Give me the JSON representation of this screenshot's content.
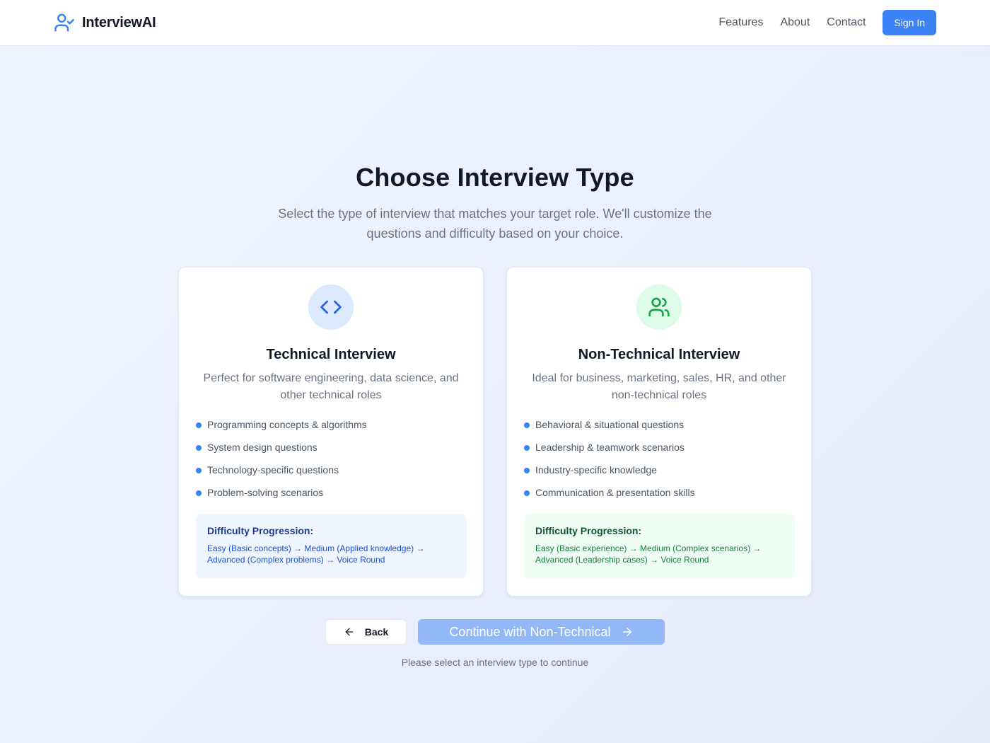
{
  "header": {
    "brand_name": "InterviewAI",
    "brand_icon": "user-check-icon",
    "nav": [
      "Features",
      "About",
      "Contact"
    ],
    "sign_in_label": "Sign In"
  },
  "hero": {
    "title": "Choose Interview Type",
    "subtitle": "Select the type of interview that matches your target role. We'll customize the questions and difficulty based on your choice."
  },
  "cards": [
    {
      "icon": "code-icon",
      "title": "Technical Interview",
      "description": "Perfect for software engineering, data science, and other technical roles",
      "features": [
        "Programming concepts & algorithms",
        "System design questions",
        "Technology-specific questions",
        "Problem-solving scenarios"
      ],
      "progression_title": "Difficulty Progression:",
      "progression_text": "Easy (Basic concepts) → Medium (Applied knowledge) → Advanced (Complex problems) → Voice Round"
    },
    {
      "icon": "users-icon",
      "title": "Non-Technical Interview",
      "description": "Ideal for business, marketing, sales, HR, and other non-technical roles",
      "features": [
        "Behavioral & situational questions",
        "Leadership & teamwork scenarios",
        "Industry-specific knowledge",
        "Communication & presentation skills"
      ],
      "progression_title": "Difficulty Progression:",
      "progression_text": "Easy (Basic experience) → Medium (Complex scenarios) → Advanced (Leadership cases) → Voice Round"
    }
  ],
  "actions": {
    "back_label": "Back",
    "continue_label": "Continue with Non-Technical",
    "hint": "Please select an interview type to continue"
  },
  "colors": {
    "primary": "#3b82f6",
    "primary_disabled": "#93b8f8",
    "tech_accent": "#dbeafe",
    "nontech_accent": "#dcfce7",
    "nontech_icon": "#16a34a"
  }
}
